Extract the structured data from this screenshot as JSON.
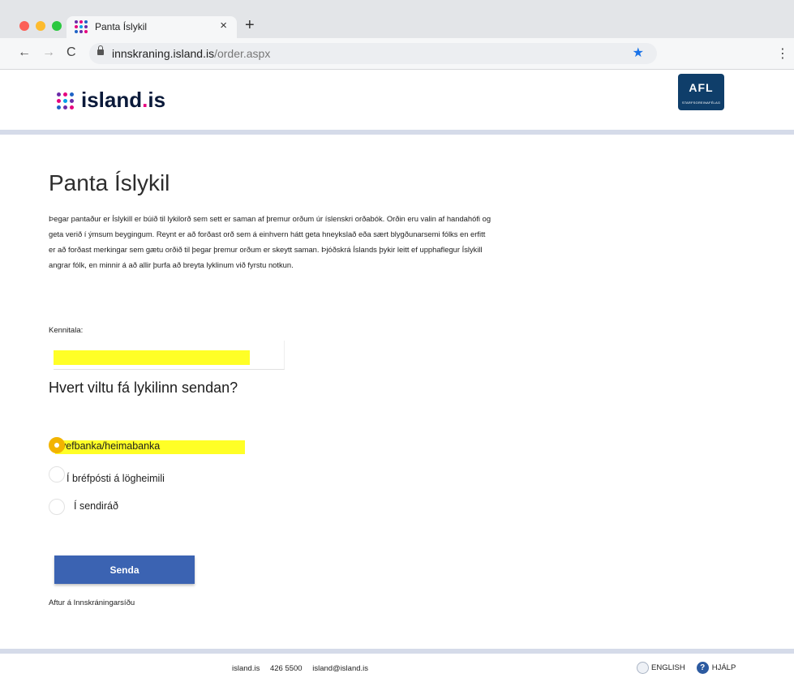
{
  "browser": {
    "tab_title": "Panta Íslykil",
    "tab_close": "×",
    "new_tab": "+",
    "url_host": "innskraning.island.is",
    "url_path": "/order.aspx",
    "back": "←",
    "forward": "→",
    "reload": "C",
    "star": "★",
    "menu": "⋮"
  },
  "header": {
    "logo_text_main": "island",
    "logo_text_dot": ".",
    "logo_text_tld": "is",
    "afl_mark": "AFL",
    "afl_sub": "STARFSGREINAFÉLAG"
  },
  "form": {
    "title": "Panta Íslykil",
    "intro": "Þegar pantaður er Íslykill er búið til lykilorð sem sett er saman af þremur orðum úr íslenskri orðabók. Orðin eru valin af handahófi og geta verið í ýmsum beygingum. Reynt er að forðast orð sem á einhvern hátt geta hneykslað eða sært blygðunarsemi fólks en erfitt er að forðast merkingar sem gætu orðið til þegar þremur orðum er skeytt saman. Þjóðskrá Íslands þykir leitt ef upphaflegur Íslykill angrar fólk, en minnir á að allir þurfa að breyta lyklinum við fyrstu notkun.",
    "ssn_label": "Kennitala:",
    "ssn_value": "",
    "question": "Hvert viltu fá lykilinn sendan?",
    "options": [
      {
        "label": "Í vefbanka/heimabanka",
        "checked": true
      },
      {
        "label": "Í bréfpósti á lögheimili",
        "checked": false
      },
      {
        "label": "Í sendiráð",
        "checked": false
      }
    ],
    "submit_label": "Senda",
    "back_link": "Aftur á Innskráningarsíðu"
  },
  "footer": {
    "site": "island.is",
    "phone": "426 5500",
    "email": "island@island.is",
    "english": "ENGLISH",
    "help": "HJÁLP",
    "help_glyph": "?"
  },
  "colors": {
    "dot_colors": [
      "#6b2ca8",
      "#e6007e",
      "#1e63c6",
      "#e6007e",
      "#00a0e9",
      "#6b2ca8",
      "#1e63c6",
      "#6b2ca8",
      "#e6007e"
    ]
  }
}
